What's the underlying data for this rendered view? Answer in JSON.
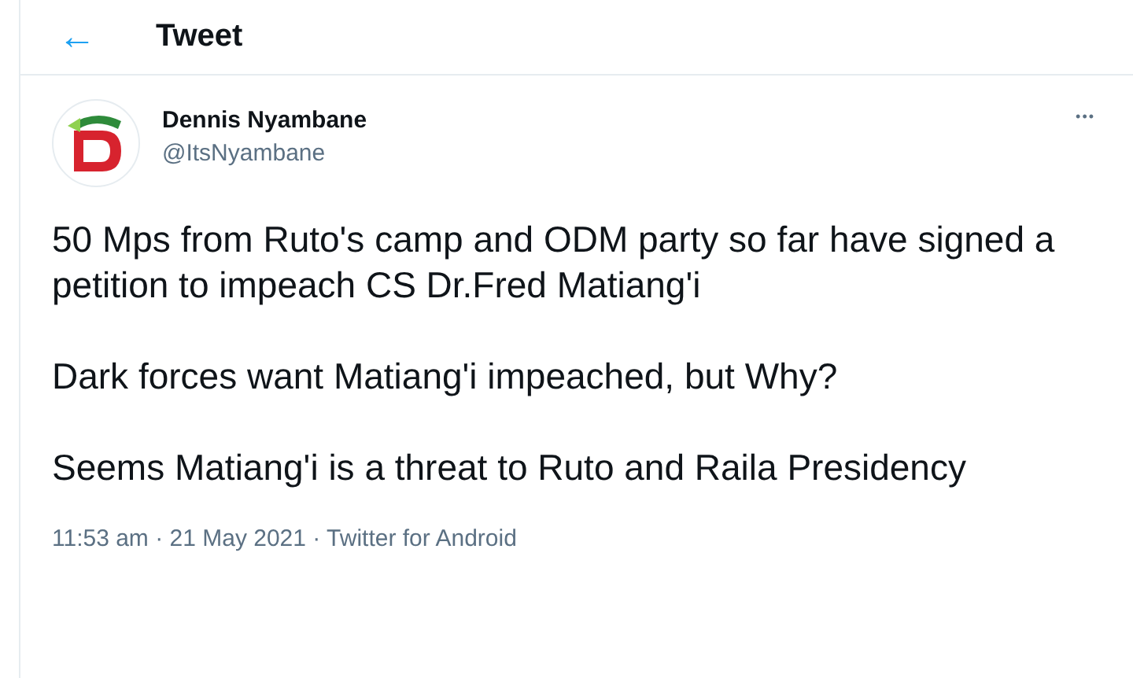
{
  "header": {
    "back": "←",
    "title": "Tweet"
  },
  "tweet": {
    "name": "Dennis Nyambane",
    "handle": "@ItsNyambane",
    "more": "•••",
    "paragraphs": [
      "50 Mps from Ruto's camp and ODM party so far have signed a petition to impeach CS Dr.Fred Matiang'i",
      "Dark forces want Matiang'i impeached, but Why?",
      "Seems Matiang'i is a threat to Ruto and Raila Presidency"
    ],
    "meta": "11:53 am · 21 May 2021 · Twitter for Android"
  }
}
